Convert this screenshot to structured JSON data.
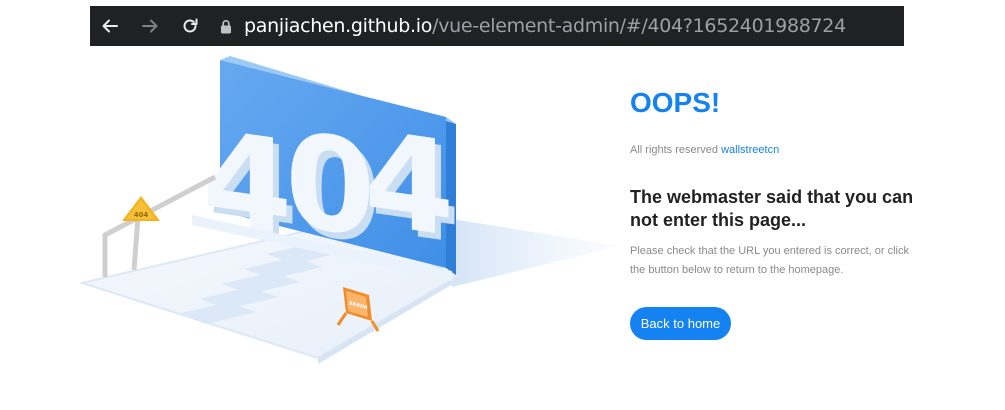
{
  "browser": {
    "back_icon": "arrow-left-icon",
    "forward_icon": "arrow-right-icon",
    "reload_icon": "reload-icon",
    "lock_icon": "lock-icon",
    "url_host": "panjiachen.github.io",
    "url_path": "/vue-element-admin/#/404?1652401988724"
  },
  "illustration": {
    "big_number": "404",
    "sign_label": "404",
    "error_label": "ERROR"
  },
  "content": {
    "oops": "OOPS!",
    "rights_prefix": "All rights reserved",
    "rights_link": "wallstreetcn",
    "headline": "The webmaster said that you can not enter this page...",
    "info": "Please check that the URL you entered is correct, or click the button below to return to the homepage.",
    "button_label": "Back to home"
  },
  "colors": {
    "accent": "#1482f0",
    "urlbar_bg": "#202124",
    "headline": "#222222",
    "muted": "#8a8a8a"
  }
}
